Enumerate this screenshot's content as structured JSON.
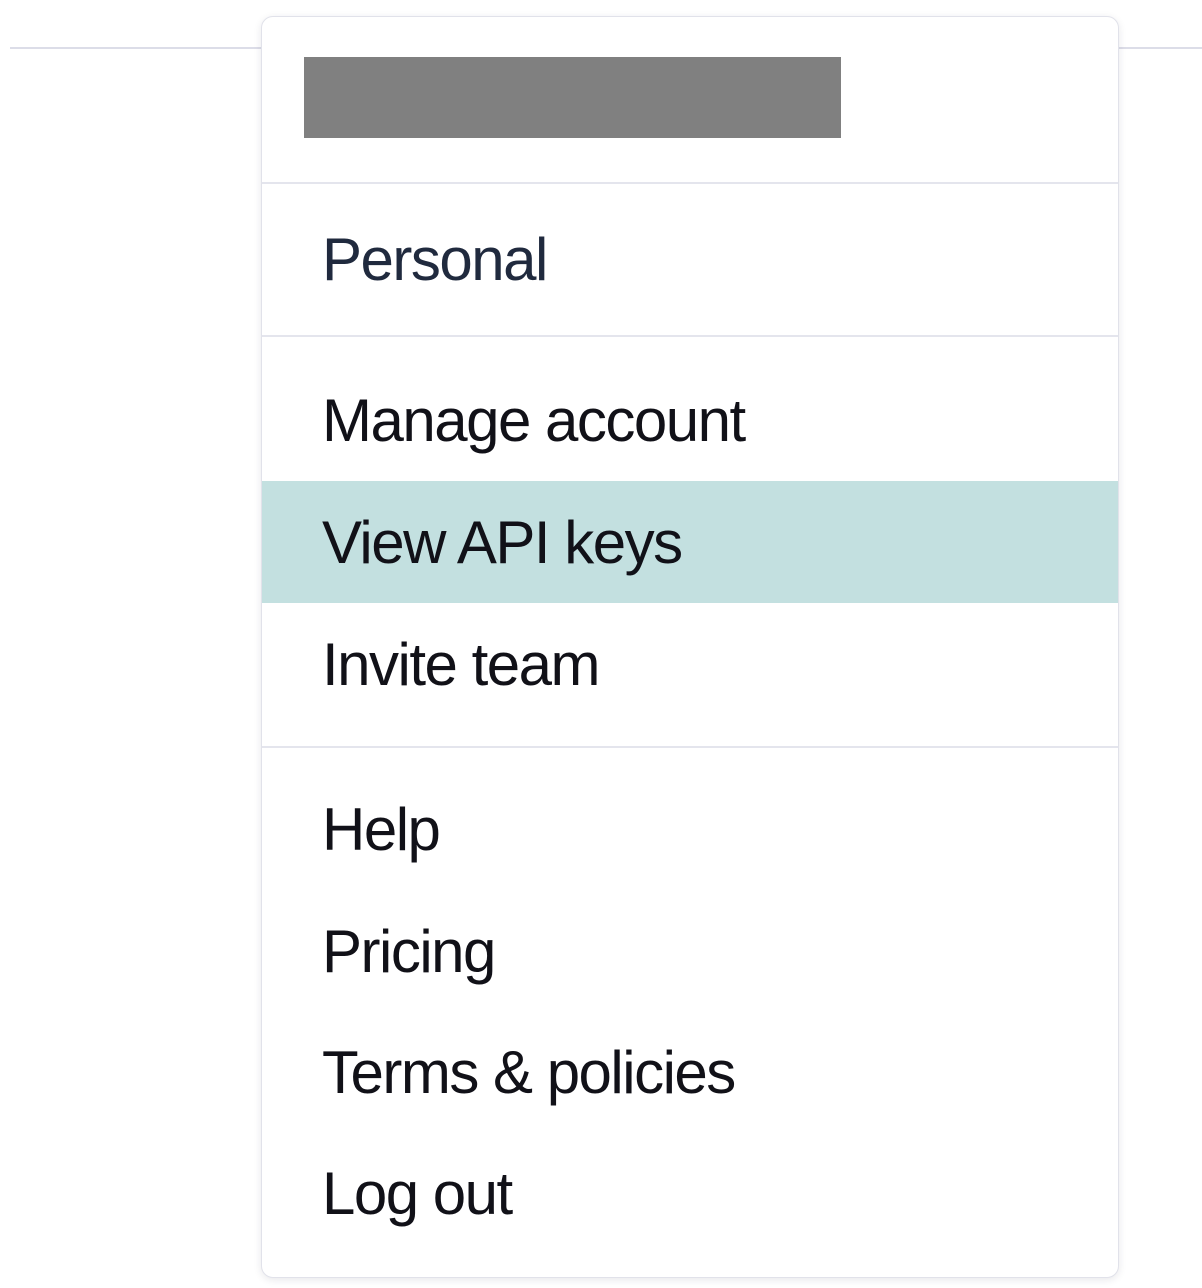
{
  "menu": {
    "header": {
      "user_name": ""
    },
    "workspace": {
      "label": "Personal"
    },
    "account_items": [
      {
        "label": "Manage account"
      },
      {
        "label": "View API keys",
        "highlighted": true
      },
      {
        "label": "Invite team"
      }
    ],
    "support_items": [
      {
        "label": "Help"
      },
      {
        "label": "Pricing"
      },
      {
        "label": "Terms & policies"
      },
      {
        "label": "Log out"
      }
    ]
  },
  "colors": {
    "highlight": "#c3e0e0",
    "redaction": "#808080",
    "divider": "#e4e5ed"
  }
}
